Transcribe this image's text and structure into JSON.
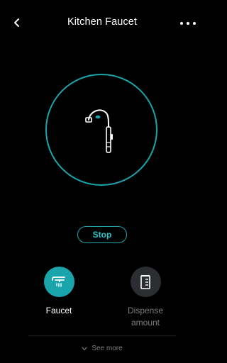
{
  "header": {
    "back_icon": "chevron-left-icon",
    "title": "Kitchen Faucet",
    "more_icon": "more-horizontal-icon"
  },
  "status": {
    "illustration": "faucet-icon"
  },
  "actions": {
    "stop_label": "Stop"
  },
  "modes": [
    {
      "label": "Faucet",
      "icon": "faucet-icon",
      "selected": true
    },
    {
      "label": "Dispense amount",
      "icon": "measuring-cup-icon",
      "selected": false
    }
  ],
  "footer": {
    "see_more_label": "See more",
    "see_more_icon": "chevron-down-icon"
  },
  "colors": {
    "accent": "#1aa5ac",
    "background": "#000000",
    "inactive_circle": "#2b2d31",
    "muted_text": "#7c7e82"
  }
}
